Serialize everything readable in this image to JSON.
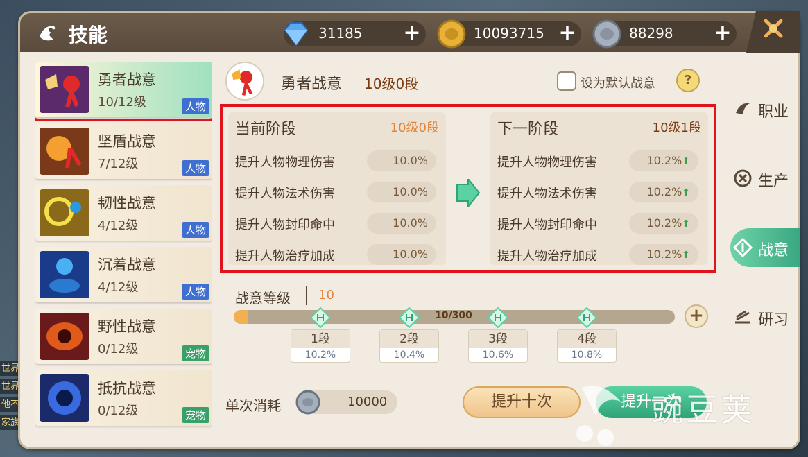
{
  "window": {
    "title": "技能"
  },
  "currencies": [
    {
      "icon": "diamond-icon",
      "value": "31185",
      "color": "#5aa8f0"
    },
    {
      "icon": "gold-coin-icon",
      "value": "10093715",
      "color": "#e8b23a"
    },
    {
      "icon": "silver-coin-icon",
      "value": "88298",
      "color": "#a6b0bc"
    }
  ],
  "chat": {
    "lines": [
      "世界",
      "世界",
      "他不",
      "家族"
    ]
  },
  "skills": [
    {
      "name": "勇者战意",
      "level": "10/12级",
      "tag": "人物",
      "selected": true
    },
    {
      "name": "坚盾战意",
      "level": "7/12级",
      "tag": "人物"
    },
    {
      "name": "韧性战意",
      "level": "4/12级",
      "tag": "人物"
    },
    {
      "name": "沉着战意",
      "level": "4/12级",
      "tag": "人物"
    },
    {
      "name": "野性战意",
      "level": "0/12级",
      "tag": "宠物"
    },
    {
      "name": "抵抗战意",
      "level": "0/12级",
      "tag": "宠物"
    }
  ],
  "header": {
    "name": "勇者战意",
    "level": "10级0段",
    "default_label": "设为默认战意",
    "help": "?"
  },
  "current_stage": {
    "title": "当前阶段",
    "level": "10级0段",
    "stats": [
      {
        "label": "提升人物物理伤害",
        "value": "10.0%"
      },
      {
        "label": "提升人物法术伤害",
        "value": "10.0%"
      },
      {
        "label": "提升人物封印命中",
        "value": "10.0%"
      },
      {
        "label": "提升人物治疗加成",
        "value": "10.0%"
      }
    ]
  },
  "next_stage": {
    "title": "下一阶段",
    "level": "10级1段",
    "stats": [
      {
        "label": "提升人物物理伤害",
        "value": "10.2%"
      },
      {
        "label": "提升人物法术伤害",
        "value": "10.2%"
      },
      {
        "label": "提升人物封印命中",
        "value": "10.2%"
      },
      {
        "label": "提升人物治疗加成",
        "value": "10.2%"
      }
    ]
  },
  "war_level": {
    "label": "战意等级",
    "value": "10",
    "progress_text": "10/300",
    "progress_fraction": 0.033,
    "plus": "+"
  },
  "segments": [
    {
      "name": "1段",
      "value": "10.2%"
    },
    {
      "name": "2段",
      "value": "10.4%"
    },
    {
      "name": "3段",
      "value": "10.6%"
    },
    {
      "name": "4段",
      "value": "10.8%"
    }
  ],
  "cost": {
    "label": "单次消耗",
    "value": "10000"
  },
  "buttons": {
    "ten": "提升十次",
    "once": "提升一次"
  },
  "right_tabs": [
    {
      "label": "职业",
      "icon": "profession-icon",
      "active": false
    },
    {
      "label": "生产",
      "icon": "production-icon",
      "active": false
    },
    {
      "label": "战意",
      "icon": "war-spirit-icon",
      "active": true
    },
    {
      "label": "研习",
      "icon": "study-icon",
      "active": false
    }
  ],
  "watermark": "豌豆荚"
}
